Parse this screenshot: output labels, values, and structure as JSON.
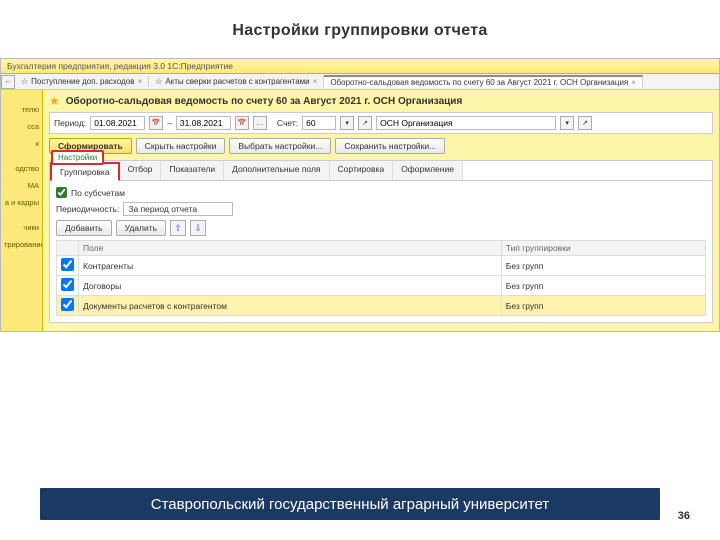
{
  "slide": {
    "title": "Настройки группировки отчета",
    "page": "36",
    "footer": "Ставропольский государственный аграрный университет"
  },
  "app": {
    "title": "Бухгалтерия предприятия, редакция 3.0  1С:Предприятие"
  },
  "tabs": [
    {
      "label": "Поступление доп. расходов"
    },
    {
      "label": "Акты сверки расчетов с контрагентами"
    },
    {
      "label": "Оборотно-сальдовая ведомость по счету 60 за Август 2021 г. ОСН Организация"
    }
  ],
  "sidebar": [
    "",
    "телю",
    "сса",
    "к",
    "",
    "одство",
    "МА",
    "а и кадры",
    "",
    "чики",
    "трирование"
  ],
  "report": {
    "title": "Оборотно-сальдовая ведомость по счету 60 за Август 2021 г. ОСН Организация",
    "period_label": "Период:",
    "date_from": "01.08.2021",
    "date_to": "31.08.2021",
    "dash": "–",
    "account_label": "Счет:",
    "account": "60",
    "org": "ОСН Организация"
  },
  "buttons": {
    "run": "Сформировать",
    "hide": "Скрыть настройки",
    "choose": "Выбрать настройки...",
    "save": "Сохранить настройки..."
  },
  "settings": {
    "panel_label": "Настройки",
    "tabs": [
      "Группировка",
      "Отбор",
      "Показатели",
      "Дополнительные поля",
      "Сортировка",
      "Оформление"
    ],
    "by_subaccounts": "По субсчетам",
    "periodicity_label": "Периодичность:",
    "periodicity_value": "За период отчета",
    "add": "Добавить",
    "delete": "Удалить",
    "col_field": "Поле",
    "col_type": "Тип группировки",
    "type_value": "Без групп",
    "rows": [
      {
        "field": "Контрагенты"
      },
      {
        "field": "Договоры"
      },
      {
        "field": "Документы расчетов с контрагентом"
      }
    ]
  }
}
